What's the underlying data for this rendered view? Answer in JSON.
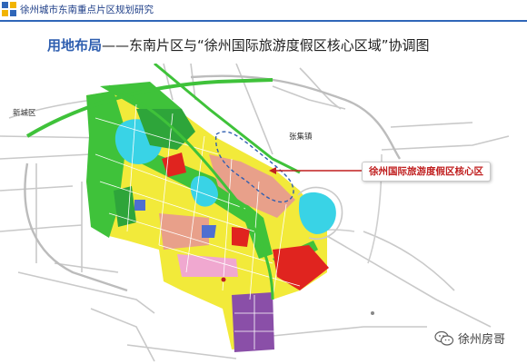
{
  "header": {
    "report_title": "徐州城市东南重点片区规划研究",
    "logo_icon": "quadrant-logo-icon"
  },
  "slide": {
    "title_highlight": "用地布局",
    "title_rest": "——东南片区与“徐州国际旅游度假区核心区域”协调图"
  },
  "map": {
    "labels": {
      "new_city_district": "新城区",
      "zhangji_town": "张集镇"
    },
    "callout": "徐州国际旅游度假区核心区",
    "colors": {
      "road_green": "#3fc23a",
      "residential_yellow": "#f2ea3a",
      "commercial_red": "#e0241f",
      "education_purple": "#8a4fa8",
      "industrial_salmon": "#e8a08a",
      "water_cyan": "#39d3e6",
      "park_green": "#2ea53a",
      "boundary_blue": "#2f5fb0"
    }
  },
  "watermark": {
    "text": "徐州房哥",
    "icon": "wechat-icon"
  }
}
